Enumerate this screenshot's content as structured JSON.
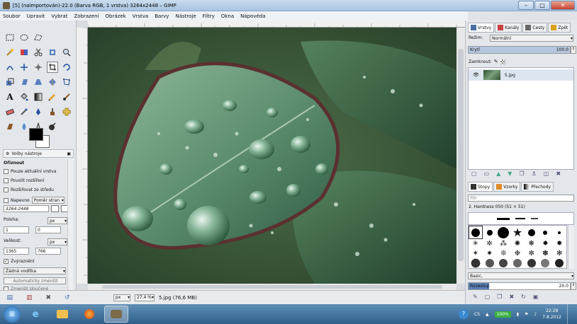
{
  "window": {
    "title": "[5] (naimportován)-22.0 (Barva RGB, 1 vrstva) 3264x2448 – GIMP",
    "minimize_label": "–",
    "maximize_label": "□",
    "close_label": "✕"
  },
  "menu": [
    "Soubor",
    "Upravit",
    "Vybrat",
    "Zobrazení",
    "Obrázek",
    "Vrstva",
    "Barvy",
    "Nástroje",
    "Filtry",
    "Okna",
    "Nápověda"
  ],
  "toolbox": {
    "tab_label": "Volby nástroje",
    "section_title": "Ořiznout",
    "current_layer_only": "Pouze aktuální vrstva",
    "allow_grow": "Povolit rozšíření",
    "expand_center": "Rozšiřovat ze středu",
    "fixed_label": "Napevno",
    "fixed_mode": "Poměr stran",
    "ratio_value": "3264:2448",
    "position_label": "Poloha:",
    "position_unit": "px",
    "position_x": "1",
    "position_y": "0",
    "size_label": "Velikost:",
    "size_unit": "px",
    "size_w": "1365",
    "size_h": "766",
    "highlight_label": "Zvýraznění",
    "guides_value": "Žádná vodítka",
    "auto_shrink": "Automaticky zmenšit",
    "shrink_merged": "Zmenšit sloučené"
  },
  "statusbar": {
    "unit": "px",
    "zoom": "27.4 %",
    "file_info": "5.jpg (76,6 MB)"
  },
  "layers_panel": {
    "tabs": [
      {
        "label": "Vrstvy",
        "color": "#4a6fa5"
      },
      {
        "label": "Kanály",
        "color": "#c94040"
      },
      {
        "label": "Cesty",
        "color": "#666666"
      },
      {
        "label": "Zpět",
        "color": "#d9a020"
      }
    ],
    "mode_label": "Režim:",
    "mode_value": "Normální",
    "opacity_label": "Krytí",
    "opacity_value": "100.0",
    "opacity_fraction": 1.0,
    "lock_label": "Zamknout:",
    "layer_name": "5.jpg"
  },
  "brushes_panel": {
    "tabs": [
      {
        "label": "Stopy",
        "color": "#333333"
      },
      {
        "label": "Vzorky",
        "color": "#e08a2a"
      },
      {
        "label": "Přechody",
        "color": "#777777"
      }
    ],
    "filter_placeholder": "filtr",
    "brush_title": "2. Hardness 050 (51 × 51)",
    "preset": "Basic,",
    "spacing_label": "Rozestup",
    "spacing_value": "20.0",
    "spacing_fraction": 0.2
  },
  "taskbar": {
    "lang": "CS",
    "battery": "100%",
    "time": "22:28",
    "date": "7.8.2012"
  }
}
